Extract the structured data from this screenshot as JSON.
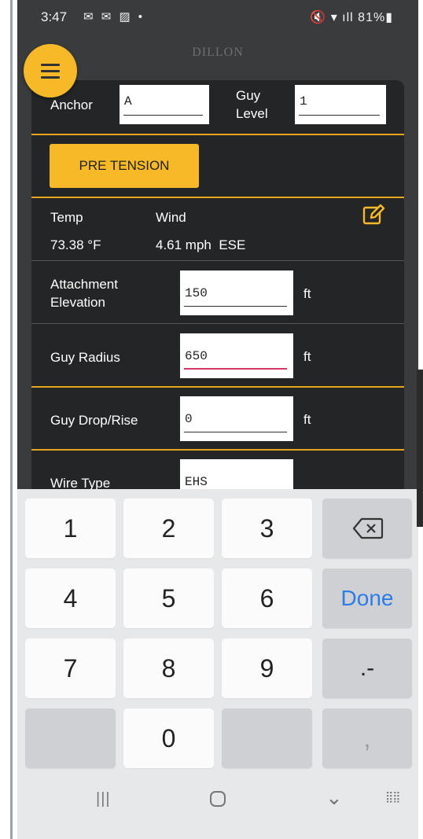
{
  "status_bar": {
    "time": "3:47",
    "notification_icons": "✉ ✉ ▨ •",
    "right_status": "🔇 ▾ ıll 81%▮"
  },
  "app": {
    "title": "DILLON"
  },
  "form": {
    "anchor_label": "Anchor",
    "anchor_value": "A",
    "guy_level_label": "Guy Level",
    "guy_level_value": "1",
    "pre_tension_label": "PRE TENSION",
    "temp_label": "Temp",
    "temp_value": "73.38 °F",
    "wind_label": "Wind",
    "wind_value": "4.61 mph  ESE",
    "attachment_elevation_label": "Attachment Elevation",
    "attachment_elevation_value": "150",
    "attachment_elevation_unit": "ft",
    "guy_radius_label": "Guy Radius",
    "guy_radius_value": "650",
    "guy_radius_unit": "ft",
    "guy_drop_label": "Guy Drop/Rise",
    "guy_drop_value": "0",
    "guy_drop_unit": "ft",
    "wire_type_label": "Wire Type",
    "wire_type_value": "EHS"
  },
  "keyboard": {
    "k1": "1",
    "k2": "2",
    "k3": "3",
    "k4": "4",
    "k5": "5",
    "k6": "6",
    "k7": "7",
    "k8": "8",
    "k9": "9",
    "k0": "0",
    "done": "Done",
    "dot_dash": ".-",
    "comma": ","
  },
  "colors": {
    "accent": "#f7b928",
    "card_bg": "#242526",
    "separator": "#e2a51c",
    "active_underline": "#d63864",
    "done_blue": "#2d7de6"
  }
}
